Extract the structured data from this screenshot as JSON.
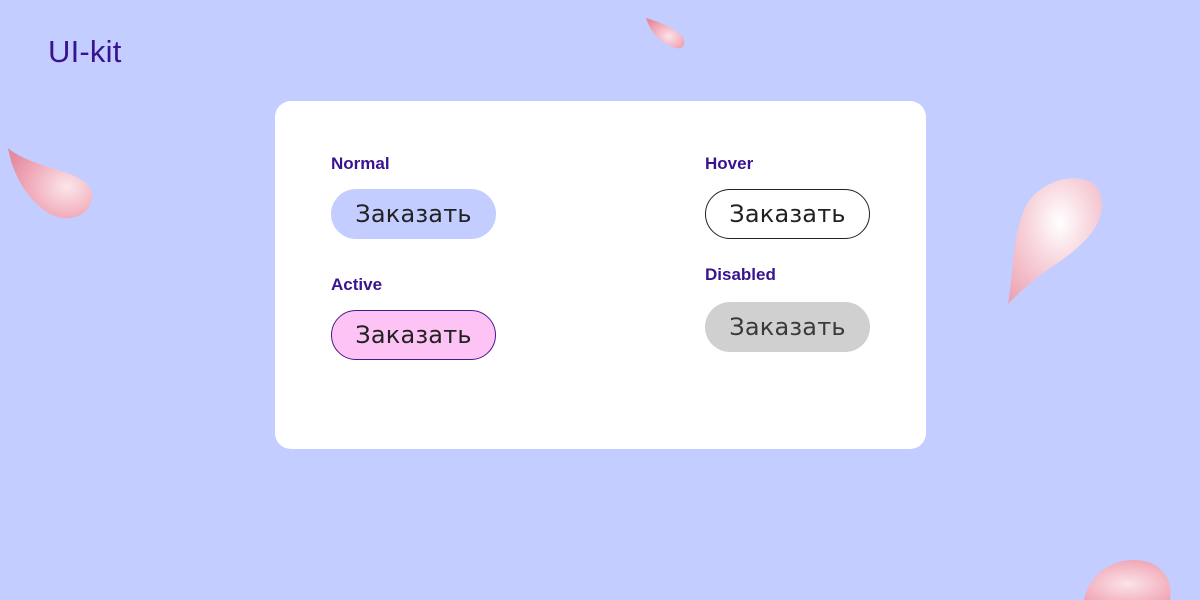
{
  "header": {
    "title": "UI-kit"
  },
  "colors": {
    "background": "#C3CDFF",
    "card": "#FFFFFF",
    "label": "#3A1390",
    "button_normal": "#C3CDFF",
    "button_active": "#FDC3F5",
    "button_active_border": "#4A1A8A",
    "button_hover_border": "#222222",
    "button_disabled": "#D0D0D0",
    "petal": "#F4B6C2"
  },
  "states": {
    "normal": {
      "label": "Normal",
      "button_text": "Заказать"
    },
    "hover": {
      "label": "Hover",
      "button_text": "Заказать"
    },
    "active": {
      "label": "Active",
      "button_text": "Заказать"
    },
    "disabled": {
      "label": "Disabled",
      "button_text": "Заказать"
    }
  },
  "decorations": {
    "petals": [
      "petal-icon",
      "petal-icon",
      "petal-icon",
      "petal-icon"
    ]
  }
}
